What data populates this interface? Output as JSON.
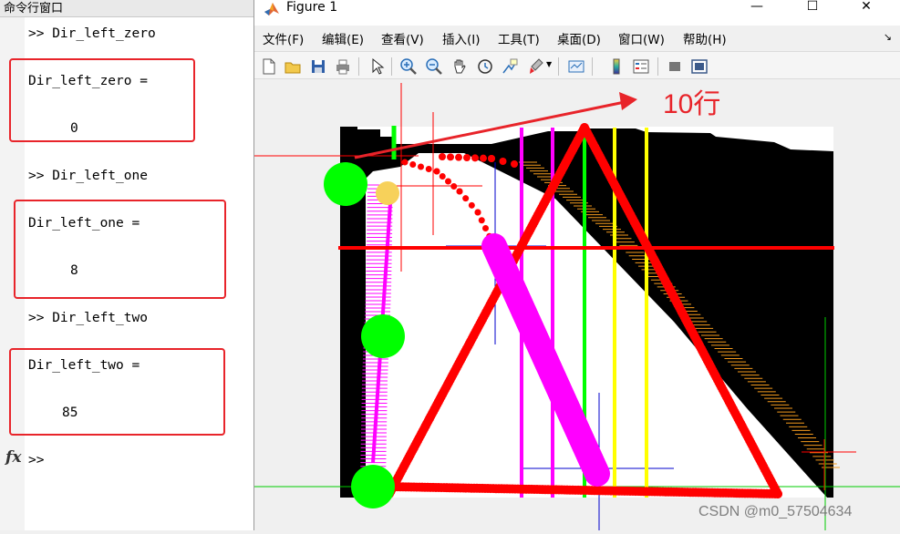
{
  "command_window": {
    "title": "命令行窗口",
    "entries": [
      {
        "prompt": ">> Dir_left_zero",
        "var_line": "Dir_left_zero =",
        "value": "0"
      },
      {
        "prompt": ">> Dir_left_one",
        "var_line": "Dir_left_one =",
        "value": "8"
      },
      {
        "prompt": ">> Dir_left_two",
        "var_line": "Dir_left_two =",
        "value": "85"
      }
    ],
    "fx_label": "fx",
    "input_prompt": ">>"
  },
  "figure": {
    "title": "Figure 1",
    "window_buttons": {
      "minimize": "—",
      "maximize": "☐",
      "close": "✕"
    },
    "menu": [
      "文件(F)",
      "编辑(E)",
      "查看(V)",
      "插入(I)",
      "工具(T)",
      "桌面(D)",
      "窗口(W)",
      "帮助(H)"
    ],
    "menu_overflow": "↘",
    "toolbar": [
      "new-figure-icon",
      "open-folder-icon",
      "save-icon",
      "print-icon",
      "pointer-icon",
      "zoom-in-icon",
      "zoom-out-icon",
      "pan-hand-icon",
      "rotate-3d-icon",
      "data-cursor-icon",
      "brush-icon",
      "link-plot-icon",
      "colorbar-icon",
      "legend-icon",
      "hide-plot-tools-icon",
      "show-plot-tools-icon"
    ],
    "annotation_label": "10行",
    "colors": {
      "red": "#ff0000",
      "green": "#00ff00",
      "magenta": "#ff00ff",
      "yellow": "#ffff00",
      "orange": "#f39a1d",
      "annotation": "#e8242a"
    }
  },
  "watermark": "CSDN @m0_57504634"
}
